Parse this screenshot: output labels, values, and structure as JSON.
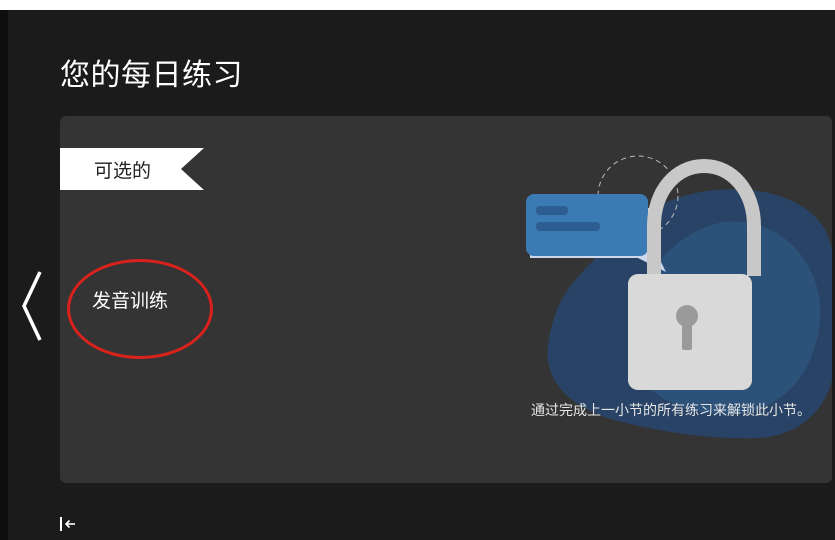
{
  "page": {
    "title": "您的每日练习"
  },
  "card": {
    "ribbon_label": "可选的",
    "item_label": "发音训练",
    "lock_message": "通过完成上一小节的所有练习来解锁此小节。"
  },
  "icons": {
    "prev": "chevron-left-icon",
    "lock": "padlock-icon",
    "chat": "chat-bubble-icon",
    "collapse": "collapse-sidebar-icon"
  },
  "colors": {
    "background": "#1b1b1b",
    "card": "#343434",
    "highlight": "#d9221c",
    "blob": "#27456a",
    "chat_bubble": "#3c7ab3"
  }
}
